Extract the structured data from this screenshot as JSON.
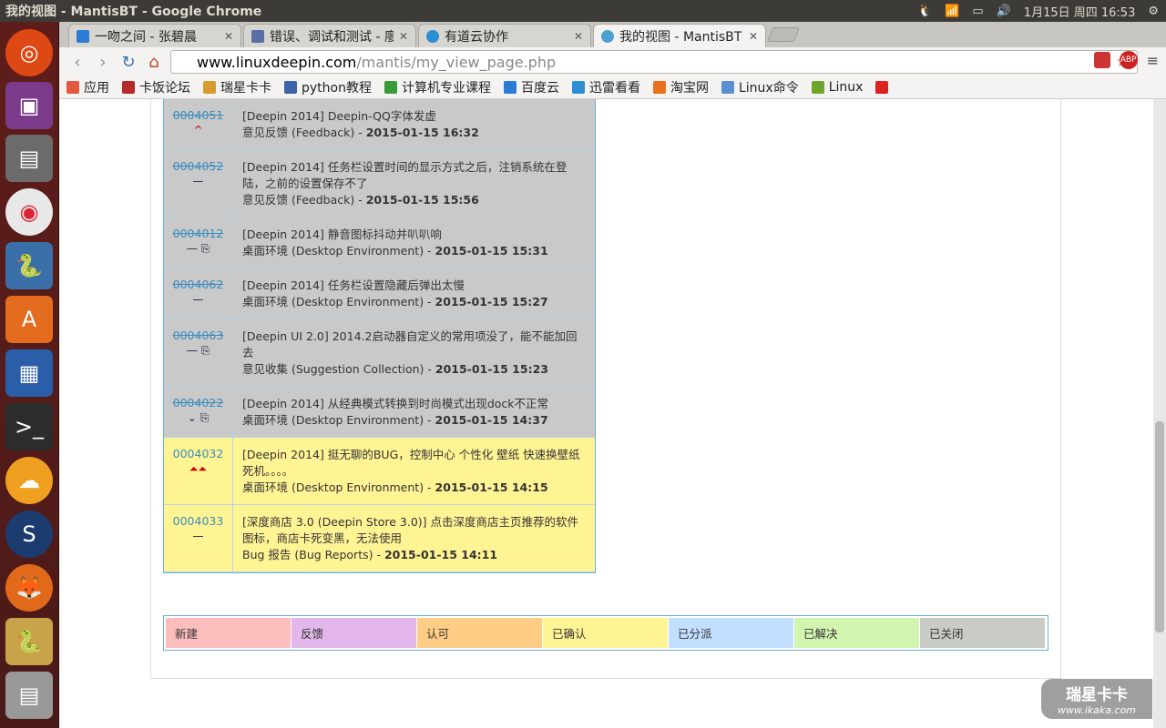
{
  "system_panel": {
    "title": "我的视图 - MantisBT - Google Chrome",
    "datetime": "1月15日 周四 16:53"
  },
  "tabs": [
    {
      "label": "一吻之间 - 张碧晨",
      "icon": "headphones-icon"
    },
    {
      "label": "错误、调试和测试 - 廖",
      "icon": "page-icon"
    },
    {
      "label": "有道云协作",
      "icon": "youdao-icon"
    },
    {
      "label": "我的视图 - MantisBT",
      "icon": "mantis-icon"
    }
  ],
  "toolbar": {
    "url_host": "www.linuxdeepin.com",
    "url_path": "/mantis/my_view_page.php"
  },
  "bookmarks": [
    {
      "label": "应用",
      "color": "#e25a3d"
    },
    {
      "label": "卡饭论坛",
      "color": "#b62b2b"
    },
    {
      "label": "瑞星卡卡",
      "color": "#d89b2e"
    },
    {
      "label": "python教程",
      "color": "#3c62a8"
    },
    {
      "label": "计算机专业课程",
      "color": "#3a9a3a"
    },
    {
      "label": "百度云",
      "color": "#2c7bd6"
    },
    {
      "label": "迅雷看看",
      "color": "#2c8fd6"
    },
    {
      "label": "淘宝网",
      "color": "#e8701e"
    },
    {
      "label": "Linux命令",
      "color": "#5a8fd0"
    },
    {
      "label": "Linux",
      "color": "#6ca72c"
    }
  ],
  "issues": [
    {
      "id": "0004051",
      "row": "gray",
      "mark": "^",
      "mark_color": "#c00",
      "summary": "[Deepin 2014] Deepin-QQ字体发虚",
      "category": "意见反馈 (Feedback)",
      "date": "2015-01-15 16:32"
    },
    {
      "id": "0004052",
      "row": "gray",
      "mark": "—",
      "mark_color": "#224",
      "summary": "[Deepin 2014] 任务栏设置时间的显示方式之后，注销系统在登陆，之前的设置保存不了",
      "category": "意见反馈 (Feedback)",
      "date": "2015-01-15 15:56"
    },
    {
      "id": "0004012",
      "row": "gray",
      "mark": "— ⎘",
      "mark_color": "#224",
      "summary": "[Deepin 2014] 静音图标抖动并叭叭响",
      "category": "桌面环境 (Desktop Environment)",
      "date": "2015-01-15 15:31"
    },
    {
      "id": "0004062",
      "row": "gray",
      "mark": "—",
      "mark_color": "#224",
      "summary": "[Deepin 2014] 任务栏设置隐藏后弹出太慢",
      "category": "桌面环境 (Desktop Environment)",
      "date": "2015-01-15 15:27"
    },
    {
      "id": "0004063",
      "row": "gray",
      "mark": "— ⎘",
      "mark_color": "#224",
      "summary": "[Deepin UI 2.0] 2014.2启动器自定义的常用项没了，能不能加回去",
      "category": "意见收集 (Suggestion Collection)",
      "date": "2015-01-15 15:23"
    },
    {
      "id": "0004022",
      "row": "gray",
      "mark": "⌄ ⎘",
      "mark_color": "#224",
      "summary": "[Deepin 2014] 从经典模式转换到时尚模式出现dock不正常",
      "category": "桌面环境 (Desktop Environment)",
      "date": "2015-01-15 14:37"
    },
    {
      "id": "0004032",
      "row": "yellow",
      "mark": "⏶⏶",
      "mark_color": "#c00",
      "summary": "[Deepin 2014] 挺无聊的BUG，控制中心 个性化 壁纸 快速换壁纸 死机。。。。",
      "category": "桌面环境 (Desktop Environment)",
      "date": "2015-01-15 14:15"
    },
    {
      "id": "0004033",
      "row": "yellow",
      "mark": "—",
      "mark_color": "#224",
      "summary": "[深度商店 3.0 (Deepin Store 3.0)] 点击深度商店主页推荐的软件图标，商店卡死变黑，无法使用",
      "category": "Bug 报告 (Bug Reports)",
      "date": "2015-01-15 14:11"
    }
  ],
  "legend": [
    {
      "label": "新建",
      "color": "#fcbdbd"
    },
    {
      "label": "反馈",
      "color": "#e3b7eb"
    },
    {
      "label": "认可",
      "color": "#ffcd85"
    },
    {
      "label": "已确认",
      "color": "#fff494"
    },
    {
      "label": "已分派",
      "color": "#c2dfff"
    },
    {
      "label": "已解决",
      "color": "#d2f5b0"
    },
    {
      "label": "已关闭",
      "color": "#c9ccc4"
    }
  ],
  "watermark": {
    "line1": "瑞星卡卡",
    "line2": "www.ikaka.com"
  }
}
